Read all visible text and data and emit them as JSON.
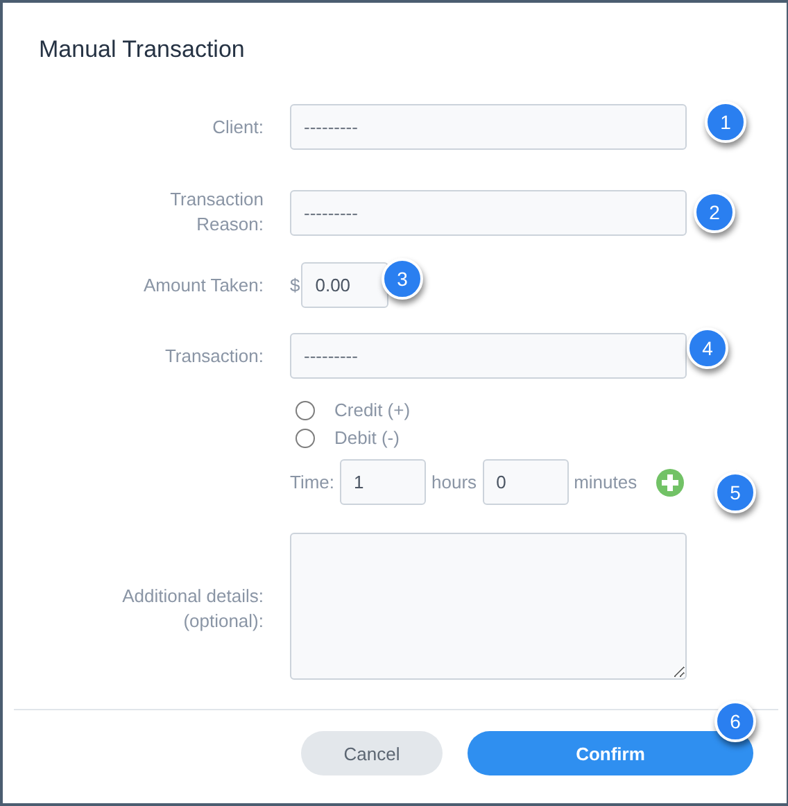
{
  "dialog": {
    "title": "Manual Transaction"
  },
  "fields": [
    {
      "kind": "select",
      "label": "Client:",
      "value": "---------"
    },
    {
      "kind": "select",
      "label": "Transaction\nReason:",
      "value": "---------"
    },
    {
      "kind": "amount",
      "label": "Amount Taken:",
      "currency": "$",
      "value": "0.00"
    },
    {
      "kind": "select",
      "label": "Transaction:",
      "value": "---------"
    },
    {
      "kind": "radio",
      "options": [
        {
          "label": "Credit (+)",
          "selected": false
        },
        {
          "label": "Debit (-)",
          "selected": false
        }
      ]
    },
    {
      "kind": "time",
      "label": "Time:",
      "hours": "1",
      "hours_unit": "hours",
      "minutes": "0",
      "minutes_unit": "minutes"
    },
    {
      "kind": "textarea",
      "label": "Additional details:\n(optional):"
    }
  ],
  "buttons": [
    {
      "kind": "secondary",
      "label": "Cancel"
    },
    {
      "kind": "primary",
      "label": "Confirm"
    }
  ],
  "callouts": [
    "1",
    "2",
    "3",
    "4",
    "5",
    "6"
  ]
}
